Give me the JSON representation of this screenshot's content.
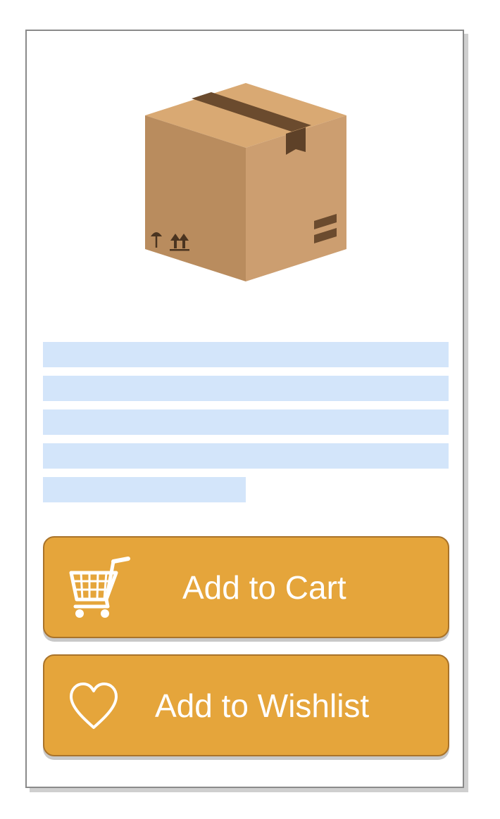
{
  "product": {
    "image_icon": "cardboard-box-icon",
    "description_placeholder_lines": 5
  },
  "actions": {
    "cart": {
      "label": "Add to Cart",
      "icon": "shopping-cart-icon"
    },
    "wishlist": {
      "label": "Add to Wishlist",
      "icon": "heart-outline-icon"
    }
  },
  "colors": {
    "button_fill": "#e5a53b",
    "button_border": "#a9732a",
    "placeholder": "#d3e5fa",
    "card_border": "#8a8a8a"
  }
}
